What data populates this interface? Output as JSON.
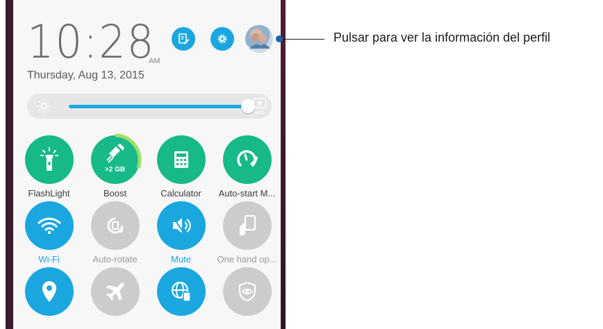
{
  "header": {
    "time": "10:28",
    "ampm": "AM",
    "date": "Thursday, Aug 13, 2015",
    "buttons": [
      {
        "name": "edit-icon",
        "color": "#1aa7e0"
      },
      {
        "name": "gear-icon",
        "color": "#1aa7e0"
      },
      {
        "name": "avatar"
      }
    ]
  },
  "brightness": {
    "level": 0.93,
    "auto_label": "AUTO"
  },
  "tiles": [
    {
      "label": "FlashLight",
      "icon": "flashlight-icon",
      "state": "on",
      "color": "#17b989"
    },
    {
      "label": "Boost",
      "icon": "boost-icon",
      "badge": ">2 GB",
      "state": "on",
      "color": "#17b989"
    },
    {
      "label": "Calculator",
      "icon": "calculator-icon",
      "state": "on",
      "color": "#17b989"
    },
    {
      "label": "Auto-start M...",
      "icon": "auto-start-icon",
      "state": "on",
      "color": "#17b989"
    },
    {
      "label": "Wi-Fi",
      "icon": "wifi-icon",
      "state": "active",
      "color": "#1aa7e0"
    },
    {
      "label": "Auto-rotate",
      "icon": "auto-rotate-icon",
      "state": "off",
      "color": "#cccccc"
    },
    {
      "label": "Mute",
      "icon": "mute-icon",
      "state": "active",
      "color": "#1aa7e0"
    },
    {
      "label": "One hand op...",
      "icon": "one-hand-icon",
      "state": "off",
      "color": "#cccccc"
    },
    {
      "label": "",
      "icon": "location-icon",
      "state": "active",
      "color": "#1aa7e0"
    },
    {
      "label": "",
      "icon": "airplane-icon",
      "state": "off",
      "color": "#cccccc"
    },
    {
      "label": "",
      "icon": "globe-icon",
      "state": "active",
      "color": "#1aa7e0"
    },
    {
      "label": "",
      "icon": "eye-shield-icon",
      "state": "off",
      "color": "#cccccc"
    }
  ],
  "callout": {
    "text": "Pulsar para ver la información del perfil"
  }
}
